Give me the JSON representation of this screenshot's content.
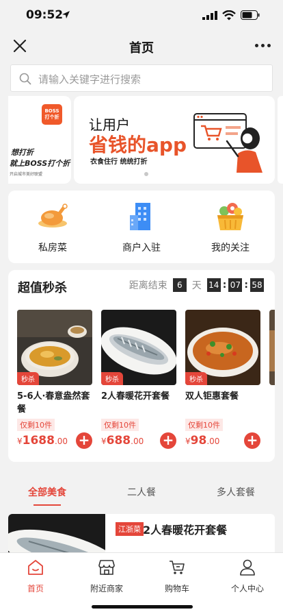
{
  "status_bar": {
    "time": "09:52"
  },
  "nav": {
    "title": "首页"
  },
  "search": {
    "placeholder": "请输入关键字进行搜索"
  },
  "banner_left": {
    "logo_line1": "BOSS",
    "logo_line2": "打个折",
    "line1": "想打折",
    "line2": "就上BOSS打个折",
    "line3": "开启城市美好联盟"
  },
  "banner": {
    "line1": "让用户",
    "line2": "省钱的app",
    "line3": "衣食住行 统统打折"
  },
  "quick_links": [
    {
      "label": "私房菜",
      "icon": "roast-chicken-icon"
    },
    {
      "label": "商户入驻",
      "icon": "building-icon"
    },
    {
      "label": "我的关注",
      "icon": "fruit-basket-icon"
    }
  ],
  "flash_sale": {
    "title": "超值秒杀",
    "countdown_label": "距离结束",
    "days": "6",
    "days_unit": "天",
    "hours": "14",
    "minutes": "07",
    "seconds": "58",
    "colon": ":",
    "products": [
      {
        "tag": "秒杀",
        "name": "5-6人·春意盎然套餐",
        "stock": "仅剩10件",
        "currency": "¥",
        "price_int": "1688",
        "price_dec": ".00"
      },
      {
        "tag": "秒杀",
        "name": "2人春暖花开套餐",
        "stock": "仅剩10件",
        "currency": "¥",
        "price_int": "688",
        "price_dec": ".00"
      },
      {
        "tag": "秒杀",
        "name": "双人钜惠套餐",
        "stock": "仅剩10件",
        "currency": "¥",
        "price_int": "98",
        "price_dec": ".00"
      }
    ],
    "add_symbol": "+"
  },
  "tabs": [
    {
      "label": "全部美食",
      "active": true
    },
    {
      "label": "二人餐",
      "active": false
    },
    {
      "label": "多人套餐",
      "active": false
    }
  ],
  "list_item": {
    "region": "江浙菜",
    "name": "2人春暖花开套餐"
  },
  "tabbar": [
    {
      "label": "首页",
      "icon": "home-icon",
      "active": true
    },
    {
      "label": "附近商家",
      "icon": "shop-icon",
      "active": false
    },
    {
      "label": "购物车",
      "icon": "cart-icon",
      "active": false
    },
    {
      "label": "个人中心",
      "icon": "person-icon",
      "active": false
    }
  ],
  "colors": {
    "accent": "#e4463a",
    "banner_orange": "#e8542a",
    "bg": "#f2f2f2"
  }
}
